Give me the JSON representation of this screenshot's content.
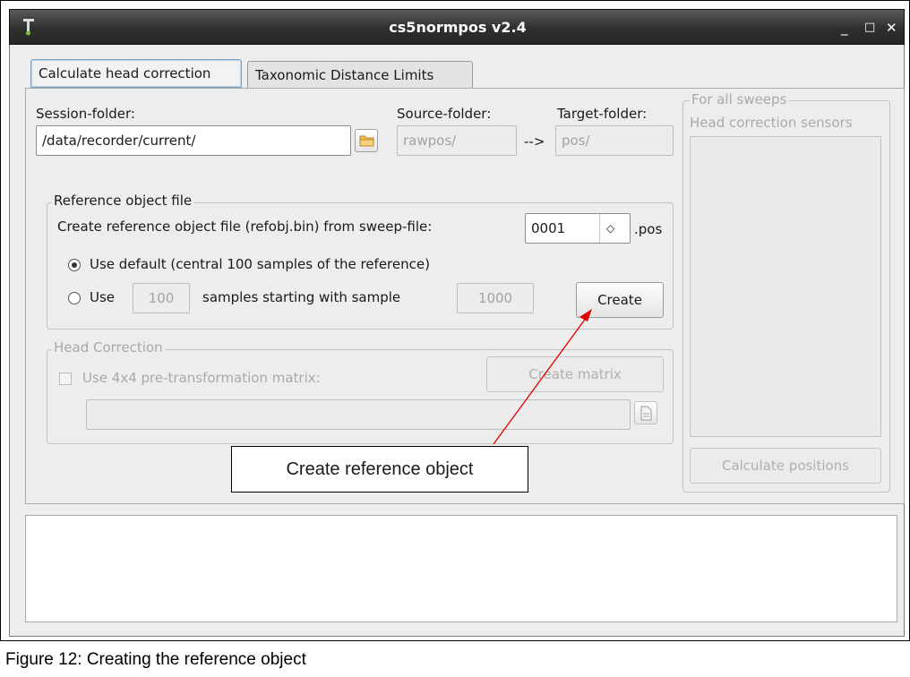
{
  "window": {
    "title": "cs5normpos v2.4",
    "minimize": "_",
    "maximize": "□",
    "close": "✕"
  },
  "tabs": [
    {
      "label": "Calculate head correction"
    },
    {
      "label": "Taxonomic Distance Limits"
    }
  ],
  "folders": {
    "session_label": "Session-folder:",
    "session_value": "/data/recorder/current/",
    "source_label": "Source-folder:",
    "source_value": "rawpos/",
    "arrow": "-->",
    "target_label": "Target-folder:",
    "target_value": "pos/"
  },
  "reference": {
    "group_label": "Reference object file",
    "prompt": "Create reference object file (refobj.bin) from sweep-file:",
    "sweep_value": "0001",
    "spin_glyph": "◇",
    "ext": ".pos",
    "option_default": "Use default (central 100 samples of the reference)",
    "option_use": "Use",
    "samples_value": "100",
    "samples_text": "samples starting with sample",
    "start_value": "1000",
    "create_button": "Create"
  },
  "head_correction": {
    "group_label": "Head Correction",
    "matrix_checkbox": "Use 4x4 pre-transformation matrix:",
    "create_matrix_button": "Create matrix",
    "matrix_path": ""
  },
  "sweeps": {
    "group_label": "For all sweeps",
    "sensors_label": "Head correction sensors",
    "calculate_button": "Calculate positions"
  },
  "annotation": {
    "text": "Create reference object",
    "color": "#e00000"
  },
  "log_text": "",
  "figure_caption": "Figure 12: Creating the reference object"
}
